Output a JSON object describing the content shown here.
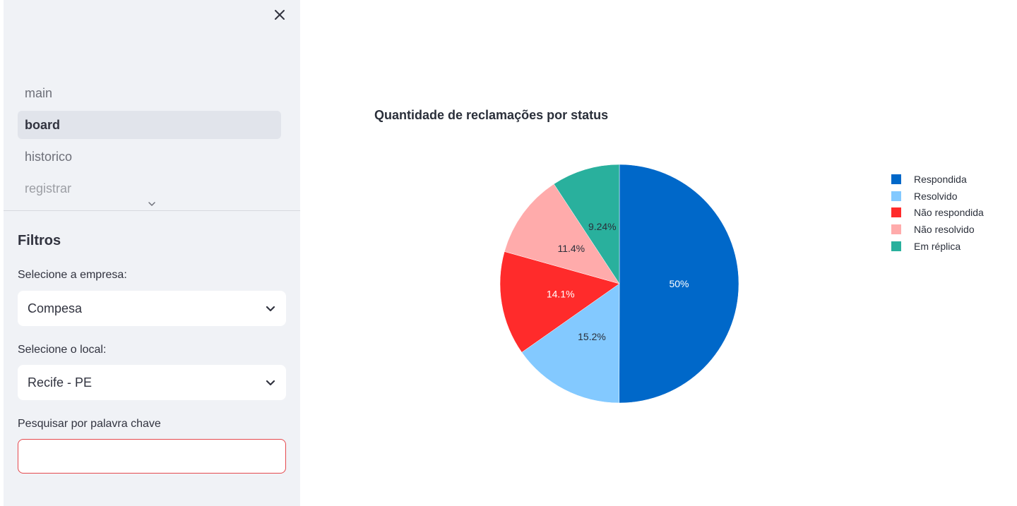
{
  "sidebar": {
    "close_icon": "close-icon",
    "nav_items": [
      {
        "label": "main",
        "active": false
      },
      {
        "label": "board",
        "active": true
      },
      {
        "label": "historico",
        "active": false
      },
      {
        "label": "registrar",
        "active": false
      }
    ],
    "expand_icon": "chevron-down-icon",
    "filters_title": "Filtros",
    "company_label": "Selecione a empresa:",
    "company_value": "Compesa",
    "location_label": "Selecione o local:",
    "location_value": "Recife - PE",
    "keyword_label": "Pesquisar por palavra chave",
    "keyword_value": ""
  },
  "chart_data": {
    "type": "pie",
    "title": "Quantidade de reclamações por status",
    "labels": [
      "Respondida",
      "Resolvido",
      "Não respondida",
      "Não resolvido",
      "Em réplica"
    ],
    "values": [
      50,
      15.2,
      14.1,
      11.4,
      9.24
    ],
    "value_labels": [
      "50%",
      "15.2%",
      "14.1%",
      "11.4%",
      "9.24%"
    ],
    "colors": [
      "#0068c9",
      "#83c9ff",
      "#ff2b2b",
      "#ffabab",
      "#29b09d"
    ],
    "label_colors": [
      "#ffffff",
      "#2a2f3a",
      "#ffffff",
      "#2a2f3a",
      "#2a2f3a"
    ],
    "legend_position": "right",
    "direction": "clockwise",
    "start": "top"
  }
}
